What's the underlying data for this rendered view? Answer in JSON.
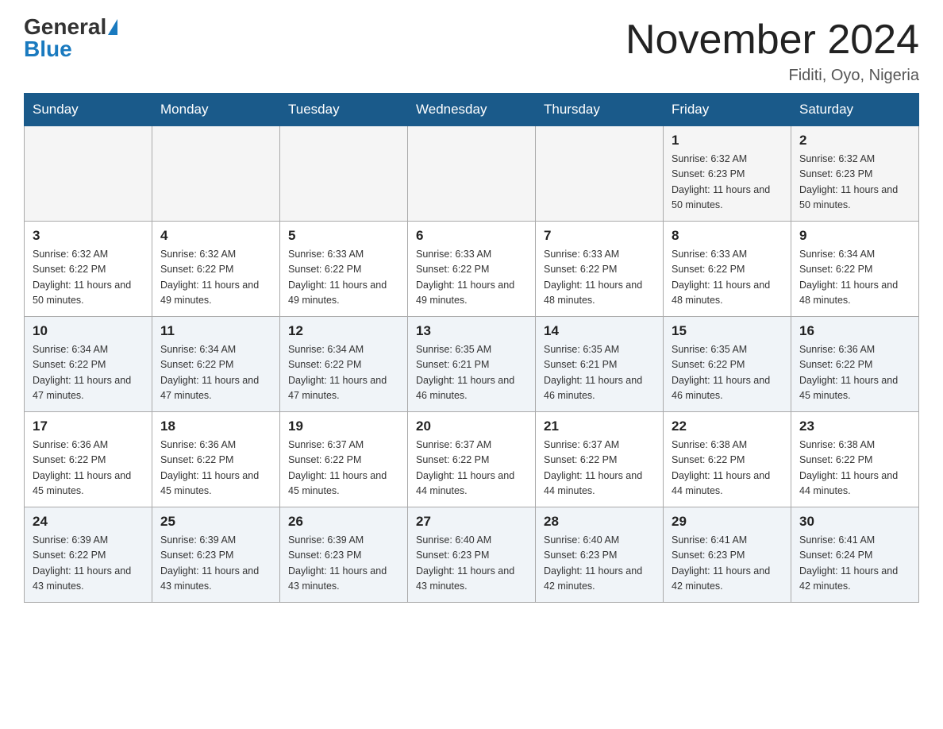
{
  "header": {
    "logo_general": "General",
    "logo_blue": "Blue",
    "title": "November 2024",
    "location": "Fiditi, Oyo, Nigeria"
  },
  "days": [
    "Sunday",
    "Monday",
    "Tuesday",
    "Wednesday",
    "Thursday",
    "Friday",
    "Saturday"
  ],
  "weeks": [
    [
      {
        "date": "",
        "info": ""
      },
      {
        "date": "",
        "info": ""
      },
      {
        "date": "",
        "info": ""
      },
      {
        "date": "",
        "info": ""
      },
      {
        "date": "",
        "info": ""
      },
      {
        "date": "1",
        "info": "Sunrise: 6:32 AM\nSunset: 6:23 PM\nDaylight: 11 hours and 50 minutes."
      },
      {
        "date": "2",
        "info": "Sunrise: 6:32 AM\nSunset: 6:23 PM\nDaylight: 11 hours and 50 minutes."
      }
    ],
    [
      {
        "date": "3",
        "info": "Sunrise: 6:32 AM\nSunset: 6:22 PM\nDaylight: 11 hours and 50 minutes."
      },
      {
        "date": "4",
        "info": "Sunrise: 6:32 AM\nSunset: 6:22 PM\nDaylight: 11 hours and 49 minutes."
      },
      {
        "date": "5",
        "info": "Sunrise: 6:33 AM\nSunset: 6:22 PM\nDaylight: 11 hours and 49 minutes."
      },
      {
        "date": "6",
        "info": "Sunrise: 6:33 AM\nSunset: 6:22 PM\nDaylight: 11 hours and 49 minutes."
      },
      {
        "date": "7",
        "info": "Sunrise: 6:33 AM\nSunset: 6:22 PM\nDaylight: 11 hours and 48 minutes."
      },
      {
        "date": "8",
        "info": "Sunrise: 6:33 AM\nSunset: 6:22 PM\nDaylight: 11 hours and 48 minutes."
      },
      {
        "date": "9",
        "info": "Sunrise: 6:34 AM\nSunset: 6:22 PM\nDaylight: 11 hours and 48 minutes."
      }
    ],
    [
      {
        "date": "10",
        "info": "Sunrise: 6:34 AM\nSunset: 6:22 PM\nDaylight: 11 hours and 47 minutes."
      },
      {
        "date": "11",
        "info": "Sunrise: 6:34 AM\nSunset: 6:22 PM\nDaylight: 11 hours and 47 minutes."
      },
      {
        "date": "12",
        "info": "Sunrise: 6:34 AM\nSunset: 6:22 PM\nDaylight: 11 hours and 47 minutes."
      },
      {
        "date": "13",
        "info": "Sunrise: 6:35 AM\nSunset: 6:21 PM\nDaylight: 11 hours and 46 minutes."
      },
      {
        "date": "14",
        "info": "Sunrise: 6:35 AM\nSunset: 6:21 PM\nDaylight: 11 hours and 46 minutes."
      },
      {
        "date": "15",
        "info": "Sunrise: 6:35 AM\nSunset: 6:22 PM\nDaylight: 11 hours and 46 minutes."
      },
      {
        "date": "16",
        "info": "Sunrise: 6:36 AM\nSunset: 6:22 PM\nDaylight: 11 hours and 45 minutes."
      }
    ],
    [
      {
        "date": "17",
        "info": "Sunrise: 6:36 AM\nSunset: 6:22 PM\nDaylight: 11 hours and 45 minutes."
      },
      {
        "date": "18",
        "info": "Sunrise: 6:36 AM\nSunset: 6:22 PM\nDaylight: 11 hours and 45 minutes."
      },
      {
        "date": "19",
        "info": "Sunrise: 6:37 AM\nSunset: 6:22 PM\nDaylight: 11 hours and 45 minutes."
      },
      {
        "date": "20",
        "info": "Sunrise: 6:37 AM\nSunset: 6:22 PM\nDaylight: 11 hours and 44 minutes."
      },
      {
        "date": "21",
        "info": "Sunrise: 6:37 AM\nSunset: 6:22 PM\nDaylight: 11 hours and 44 minutes."
      },
      {
        "date": "22",
        "info": "Sunrise: 6:38 AM\nSunset: 6:22 PM\nDaylight: 11 hours and 44 minutes."
      },
      {
        "date": "23",
        "info": "Sunrise: 6:38 AM\nSunset: 6:22 PM\nDaylight: 11 hours and 44 minutes."
      }
    ],
    [
      {
        "date": "24",
        "info": "Sunrise: 6:39 AM\nSunset: 6:22 PM\nDaylight: 11 hours and 43 minutes."
      },
      {
        "date": "25",
        "info": "Sunrise: 6:39 AM\nSunset: 6:23 PM\nDaylight: 11 hours and 43 minutes."
      },
      {
        "date": "26",
        "info": "Sunrise: 6:39 AM\nSunset: 6:23 PM\nDaylight: 11 hours and 43 minutes."
      },
      {
        "date": "27",
        "info": "Sunrise: 6:40 AM\nSunset: 6:23 PM\nDaylight: 11 hours and 43 minutes."
      },
      {
        "date": "28",
        "info": "Sunrise: 6:40 AM\nSunset: 6:23 PM\nDaylight: 11 hours and 42 minutes."
      },
      {
        "date": "29",
        "info": "Sunrise: 6:41 AM\nSunset: 6:23 PM\nDaylight: 11 hours and 42 minutes."
      },
      {
        "date": "30",
        "info": "Sunrise: 6:41 AM\nSunset: 6:24 PM\nDaylight: 11 hours and 42 minutes."
      }
    ]
  ]
}
